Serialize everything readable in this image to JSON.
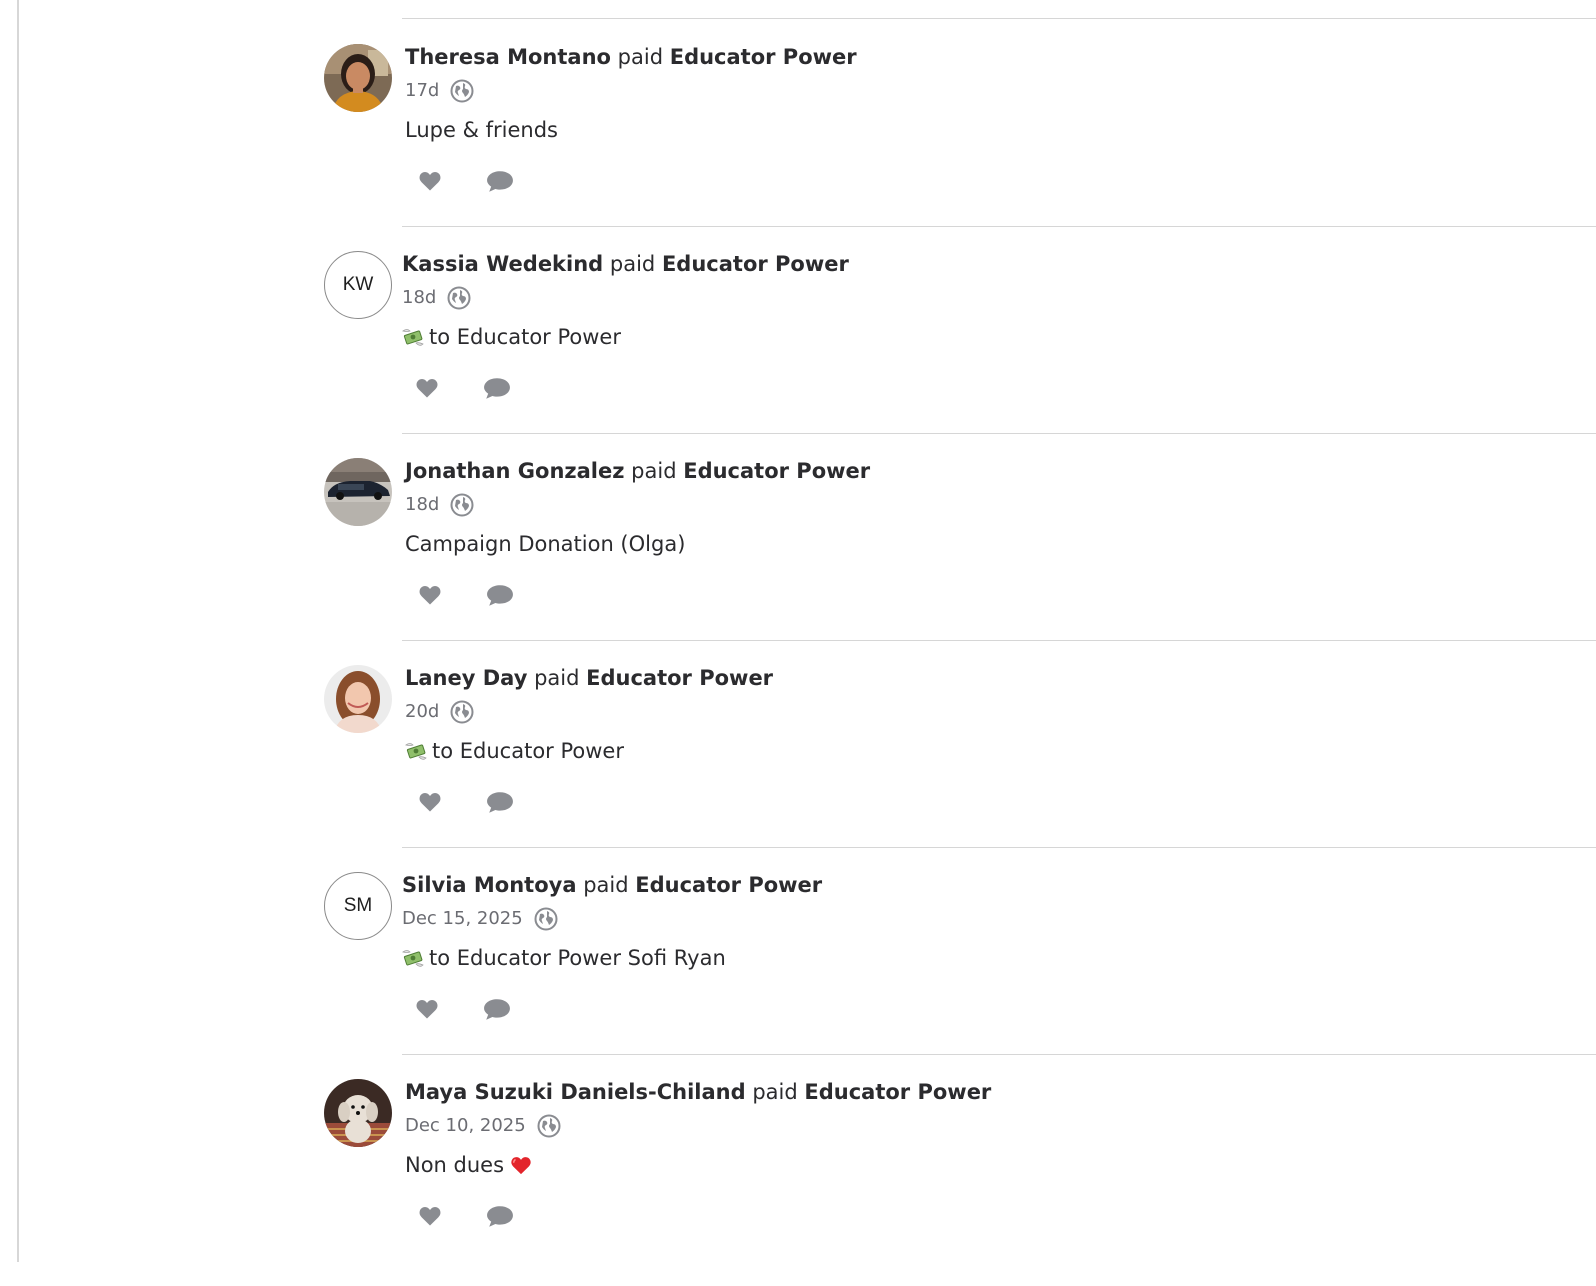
{
  "feed": {
    "stories": [
      {
        "actor": "Theresa Montano",
        "verb": "paid",
        "target": "Educator Power",
        "time": "17d",
        "note": "Lupe & friends",
        "avatar": {
          "kind": "photo",
          "icon": "person-photo-avatar"
        }
      },
      {
        "actor": "Kassia Wedekind",
        "verb": "paid",
        "target": "Educator Power",
        "time": "18d",
        "note": "to Educator Power",
        "note_emoji": "money-with-wings",
        "avatar": {
          "kind": "initials",
          "initials": "KW"
        }
      },
      {
        "actor": "Jonathan Gonzalez",
        "verb": "paid",
        "target": "Educator Power",
        "time": "18d",
        "note": "Campaign Donation (Olga)",
        "avatar": {
          "kind": "photo",
          "icon": "car-photo-avatar"
        }
      },
      {
        "actor": "Laney Day",
        "verb": "paid",
        "target": "Educator Power",
        "time": "20d",
        "note": "to Educator Power",
        "note_emoji": "money-with-wings",
        "avatar": {
          "kind": "photo",
          "icon": "person-photo-avatar"
        }
      },
      {
        "actor": "Silvia Montoya",
        "verb": "paid",
        "target": "Educator Power",
        "time": "Dec 15, 2025",
        "note": "to Educator Power Sofi Ryan",
        "note_emoji": "money-with-wings",
        "avatar": {
          "kind": "initials",
          "initials": "SM"
        }
      },
      {
        "actor": "Maya Suzuki Daniels-Chiland",
        "verb": "paid",
        "target": "Educator Power",
        "time": "Dec 10, 2025",
        "note": "Non dues",
        "note_trailing_emoji": "red-heart",
        "avatar": {
          "kind": "photo",
          "icon": "dog-photo-avatar"
        }
      }
    ],
    "icons": {
      "audience": "globe-icon",
      "like": "heart-icon",
      "comment": "comment-bubble-icon"
    },
    "colors": {
      "text": "#2b2b2e",
      "meta": "#6b6c72",
      "icon": "#8a8c91",
      "divider": "#d6d6d6"
    }
  }
}
